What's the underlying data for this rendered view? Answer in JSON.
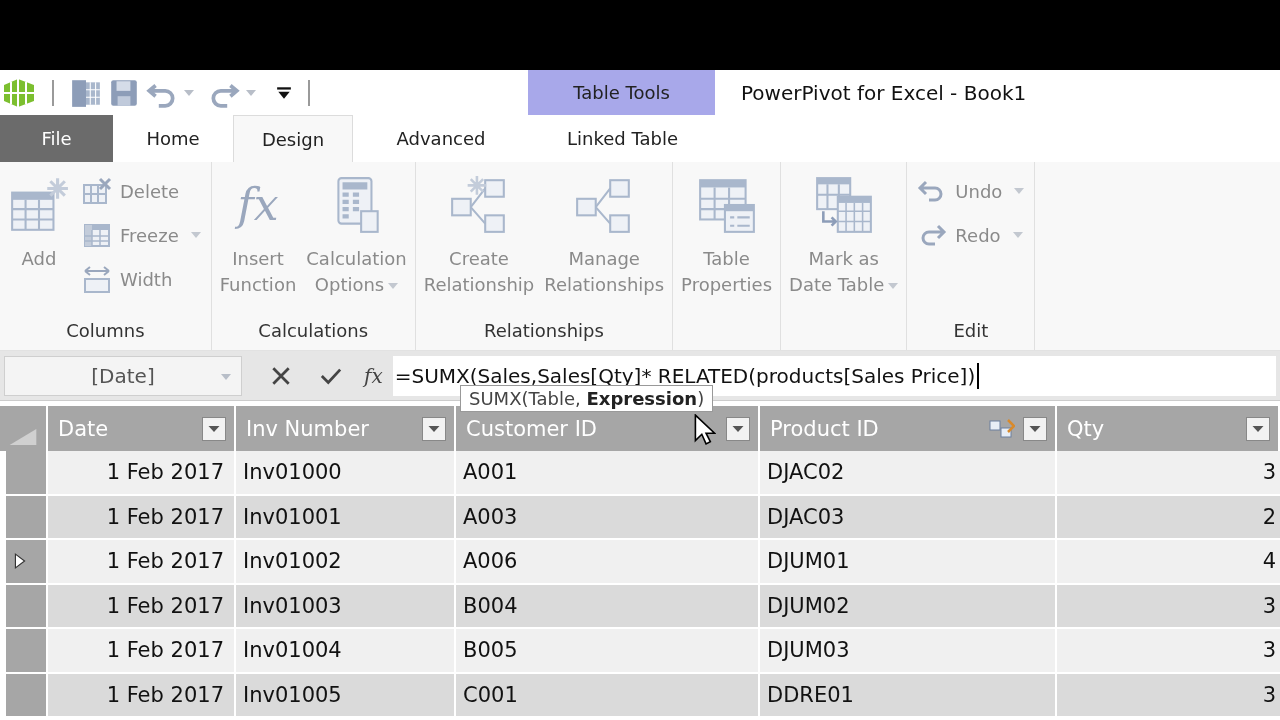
{
  "context_tab_group": {
    "label": "Table Tools"
  },
  "window": {
    "title": "PowerPivot for Excel - Book1"
  },
  "tabs": [
    {
      "label": "File",
      "kind": "file",
      "selected": false
    },
    {
      "label": "Home",
      "kind": "normal",
      "selected": false
    },
    {
      "label": "Design",
      "kind": "normal",
      "selected": true
    },
    {
      "label": "Advanced",
      "kind": "normal",
      "selected": false
    },
    {
      "label": "Linked Table",
      "kind": "contextual",
      "selected": false
    }
  ],
  "ribbon": {
    "groups": [
      {
        "label": "Columns",
        "buttons": [
          {
            "label": "Add",
            "kind": "add",
            "disabled": true,
            "dropdown": false
          },
          {
            "label": "Delete",
            "kind": "delete",
            "disabled": true,
            "dropdown": false
          },
          {
            "label": "Freeze",
            "kind": "freeze",
            "disabled": true,
            "dropdown": true
          },
          {
            "label": "Width",
            "kind": "width",
            "disabled": true,
            "dropdown": false
          }
        ]
      },
      {
        "label": "Calculations",
        "buttons": [
          {
            "label": "Insert\nFunction",
            "kind": "function",
            "glyph": "fx",
            "disabled": true,
            "dropdown": false
          },
          {
            "label": "Calculation\nOptions",
            "kind": "calculator",
            "disabled": true,
            "dropdown": true
          }
        ]
      },
      {
        "label": "Relationships",
        "buttons": [
          {
            "label": "Create\nRelationship",
            "kind": "create",
            "disabled": true,
            "dropdown": false
          },
          {
            "label": "Manage\nRelationships",
            "kind": "manage",
            "disabled": true,
            "dropdown": false
          }
        ]
      },
      {
        "buttons": [
          {
            "label": "Table\nProperties",
            "kind": "properties",
            "disabled": true,
            "dropdown": false
          }
        ]
      },
      {
        "buttons": [
          {
            "label": "Mark as\nDate Table",
            "kind": "calendar",
            "disabled": true,
            "dropdown": true
          }
        ]
      },
      {
        "label": "Edit",
        "buttons": [
          {
            "label": "Undo",
            "kind": "undo",
            "disabled": true,
            "dropdown": true
          },
          {
            "label": "Redo",
            "kind": "redo",
            "disabled": true,
            "dropdown": true
          }
        ]
      }
    ]
  },
  "formula_bar": {
    "name_box": "[Date]",
    "function_symbol": "fx",
    "formula": "=SUMX(Sales,Sales[Qty]* RELATED(products[Sales Price])",
    "tooltip": "SUMX(Table, **Expression**)"
  },
  "table": {
    "columns": [
      {
        "label": "Date",
        "kind": "date",
        "related": false
      },
      {
        "label": "Inv Number",
        "kind": "text",
        "related": false
      },
      {
        "label": "Customer ID",
        "kind": "text",
        "related": false
      },
      {
        "label": "Product ID",
        "kind": "text",
        "related": true
      },
      {
        "label": "Qty",
        "kind": "number",
        "related": false
      }
    ],
    "rows": [
      {
        "selected": false,
        "cells": [
          "1 Feb 2017",
          "Inv01000",
          "A001",
          "DJAC02",
          "3"
        ]
      },
      {
        "selected": false,
        "cells": [
          "1 Feb 2017",
          "Inv01001",
          "A003",
          "DJAC03",
          "2"
        ]
      },
      {
        "selected": true,
        "cells": [
          "1 Feb 2017",
          "Inv01002",
          "A006",
          "DJUM01",
          "4"
        ]
      },
      {
        "selected": false,
        "cells": [
          "1 Feb 2017",
          "Inv01003",
          "B004",
          "DJUM02",
          "3"
        ]
      },
      {
        "selected": false,
        "cells": [
          "1 Feb 2017",
          "Inv01004",
          "B005",
          "DJUM03",
          "3"
        ]
      },
      {
        "selected": false,
        "cells": [
          "1 Feb 2017",
          "Inv01005",
          "C001",
          "DDRE01",
          "3"
        ]
      }
    ]
  }
}
